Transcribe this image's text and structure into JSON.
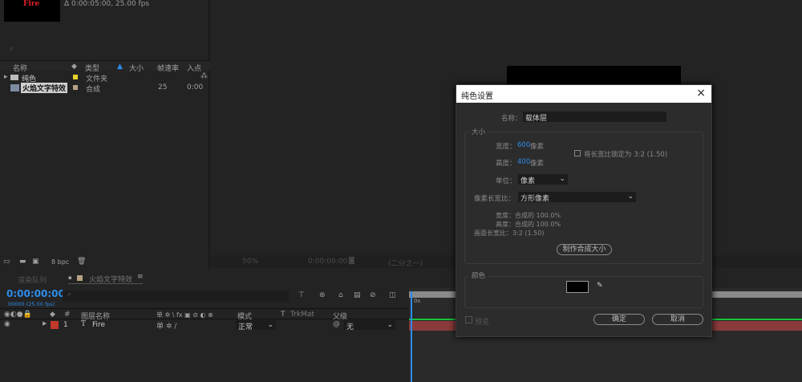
{
  "project": {
    "thumb_text": "Fire",
    "info": "Δ 0:00:05:00, 25.00 fps",
    "columns": [
      "名称",
      "类型",
      "大小",
      "帧速率",
      "入点"
    ],
    "items": [
      {
        "name": "纯色",
        "type": "文件夹",
        "color": "#e4d42a",
        "fps": "",
        "in": ""
      },
      {
        "name": "火焰文字特效",
        "type": "合成",
        "color": "#b9a184",
        "fps": "25",
        "in": "0:00"
      }
    ],
    "bpc": "8 bpc"
  },
  "viewer": {
    "zoom": "50%",
    "time": "0:00:00:00",
    "view": "(二分之一)"
  },
  "timeline": {
    "tabs": [
      "渲染队列",
      "火焰文字特效"
    ],
    "timecode": "0:00:00:00",
    "frames": "00000 (25.00 fps)",
    "columns": {
      "num": "#",
      "name": "图层名称",
      "switches": "单 ✲ \\ fx ▣ ⊘ ◐ ⊕",
      "mode": "模式",
      "t": "T",
      "trkmat": "TrkMat",
      "parent": "父级"
    },
    "layers": [
      {
        "index": "1",
        "name": "Fire",
        "mode": "正常",
        "parent": "无",
        "color": "#c0392b"
      }
    ],
    "ruler": "0s"
  },
  "dialog": {
    "title": "纯色设置",
    "name_label": "名称：",
    "name_value": "载体层",
    "size_group": "大小",
    "width_label": "宽度：",
    "width_value": "600",
    "unit_px": "像素",
    "height_label": "高度：",
    "height_value": "400",
    "lock_label": "将长宽比锁定为 3:2 (1.50)",
    "units_label": "单位：",
    "units_value": "像素",
    "par_label": "像素长宽比：",
    "par_value": "方形像素",
    "info_w": "宽度：合成的 100.0%",
    "info_h": "高度：合成的 100.0%",
    "info_ar": "画面长宽比：3:2 (1.50)",
    "make_comp_size": "制作合成大小",
    "color_group": "颜色",
    "color_value": "#000000",
    "preview": "预览",
    "ok": "确定",
    "cancel": "取消"
  }
}
